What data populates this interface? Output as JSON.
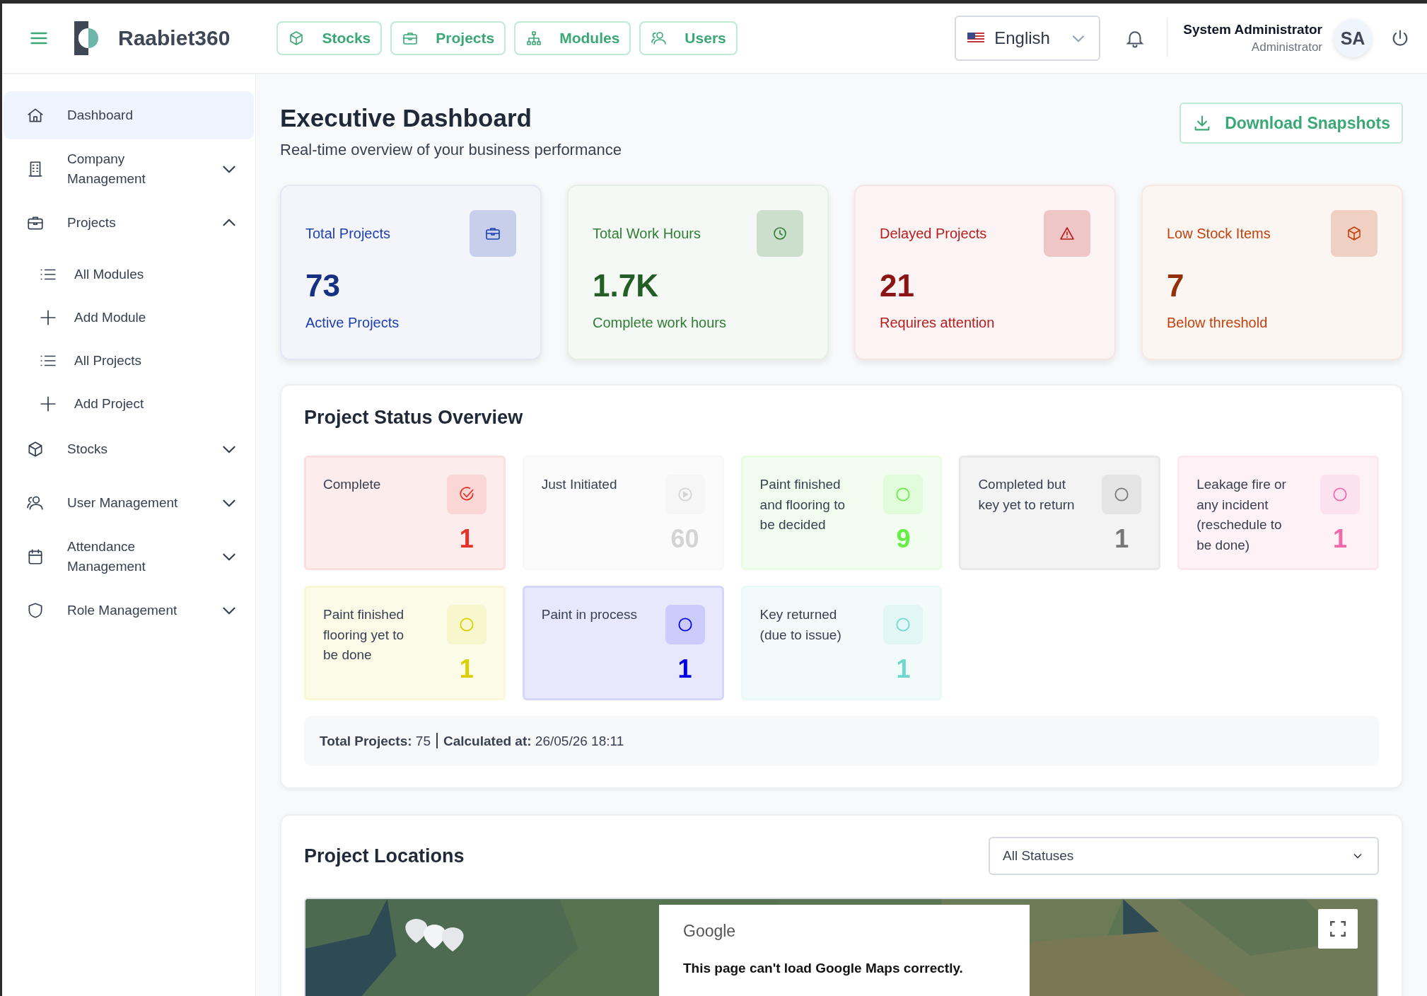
{
  "app": {
    "name": "Raabiet360"
  },
  "top_nav": [
    {
      "label": "Stocks"
    },
    {
      "label": "Projects"
    },
    {
      "label": "Modules"
    },
    {
      "label": "Users"
    }
  ],
  "language": {
    "value": "English"
  },
  "user": {
    "name": "System Administrator",
    "role": "Administrator",
    "initials": "SA"
  },
  "sidebar": {
    "items": [
      {
        "label": "Dashboard",
        "selected": true
      },
      {
        "label": "Company Management",
        "selected": false,
        "expanded": false
      },
      {
        "label": "Projects",
        "selected": false,
        "expanded": true,
        "children": [
          {
            "label": "All Modules",
            "kind": "list"
          },
          {
            "label": "Add Module",
            "kind": "add"
          },
          {
            "label": "All Projects",
            "kind": "list"
          },
          {
            "label": "Add Project",
            "kind": "add"
          }
        ]
      },
      {
        "label": "Stocks",
        "selected": false,
        "expanded": false
      },
      {
        "label": "User Management",
        "selected": false,
        "expanded": false
      },
      {
        "label": "Attendance Management",
        "selected": false,
        "expanded": false
      },
      {
        "label": "Role Management",
        "selected": false,
        "expanded": false
      }
    ]
  },
  "page": {
    "title": "Executive Dashboard",
    "subtitle": "Real-time overview of your business performance",
    "action": "Download Snapshots"
  },
  "stats": [
    {
      "title": "Total Projects",
      "value": "73",
      "caption": "Active Projects",
      "color": "#1e40af"
    },
    {
      "title": "Total Work Hours",
      "value": "1.7K",
      "caption": "Complete work hours",
      "color": "#2e7d32"
    },
    {
      "title": "Delayed Projects",
      "value": "21",
      "caption": "Requires attention",
      "color": "#b91c1c"
    },
    {
      "title": "Low Stock Items",
      "value": "7",
      "caption": "Below threshold",
      "color": "#c2410c"
    }
  ],
  "status_overview": {
    "title": "Project Status Overview",
    "items": [
      {
        "label": "Complete",
        "count": "1",
        "color": "#e5312b",
        "kind": "check"
      },
      {
        "label": "Just Initiated",
        "count": "60",
        "color": "#d4d4d4",
        "kind": "play"
      },
      {
        "label": "Paint finished and flooring to be decided",
        "count": "9",
        "color": "#66ee44",
        "kind": "circle"
      },
      {
        "label": "Completed but key yet to return",
        "count": "1",
        "color": "#777777",
        "kind": "circle"
      },
      {
        "label": "Leakage fire or any incident (reschedule to be done)",
        "count": "1",
        "color": "#f06aaa",
        "kind": "circle"
      },
      {
        "label": "Paint finished flooring yet to be done",
        "count": "1",
        "color": "#d8d000",
        "kind": "circle"
      },
      {
        "label": "Paint in process",
        "count": "1",
        "color": "#0000ee",
        "kind": "circle"
      },
      {
        "label": "Key returned (due to issue)",
        "count": "1",
        "color": "#6fd8cc",
        "kind": "circle"
      }
    ],
    "footer": {
      "total_label": "Total Projects:",
      "total": "75",
      "calc_label": "Calculated at:",
      "calc": "26/05/26 18:11"
    }
  },
  "locations": {
    "title": "Project Locations",
    "filter": "All Statuses",
    "map_error": {
      "brand": "Google",
      "message": "This page can't load Google Maps correctly."
    }
  }
}
